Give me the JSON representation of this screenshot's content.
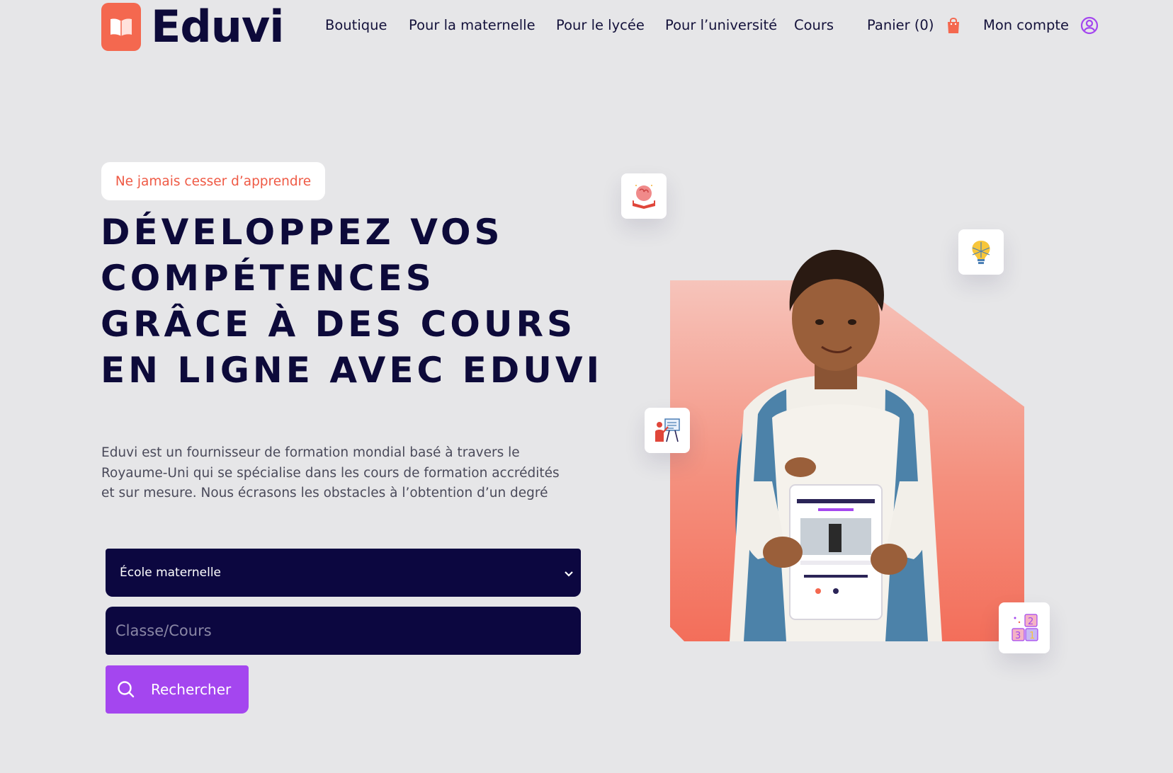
{
  "brand": {
    "name": "Eduvi",
    "color": "#f4684f"
  },
  "nav": {
    "items": [
      "Boutique",
      "Pour la maternelle",
      "Pour le lycée",
      "Pour l’université",
      "Cours"
    ],
    "cart_label": "Panier (0)",
    "account_label": "Mon compte"
  },
  "hero": {
    "tag": "Ne jamais cesser d’apprendre",
    "headline": [
      "DÉVELOPPEZ VOS",
      "COMPÉTENCES",
      "GRÂCE À DES COURS",
      "EN LIGNE AVEC EDUVI"
    ],
    "description": [
      "Eduvi est un fournisseur de formation mondial basé à travers le",
      "Royaume-Uni qui se spécialise dans les cours de formation accrédités",
      "et sur mesure. Nous écrasons les obstacles à l’obtention d’un degré"
    ]
  },
  "form": {
    "level_selected": "École maternelle",
    "class_placeholder": "Classe/Cours",
    "search_label": "Rechercher"
  },
  "icons": [
    "book-brain-icon",
    "lightbulb-icon",
    "teacher-board-icon",
    "number-blocks-icon",
    "shopping-bag-icon",
    "user-circle-icon",
    "search-icon",
    "chevron-down-icon"
  ],
  "colors": {
    "accent": "#a446ef",
    "navy": "#0c0740",
    "coral": "#f36e5a"
  }
}
